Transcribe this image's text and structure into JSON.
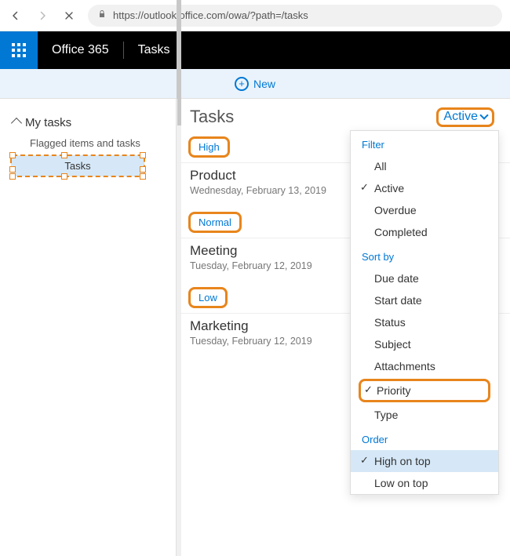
{
  "browser": {
    "url": "https://outlook.office.com/owa/?path=/tasks"
  },
  "suite": {
    "brand": "Office 365",
    "app": "Tasks"
  },
  "toolbar": {
    "new_label": "New"
  },
  "sidebar": {
    "header": "My tasks",
    "items": [
      {
        "label": "Flagged items and tasks",
        "selected": false
      },
      {
        "label": "Tasks",
        "selected": true
      }
    ]
  },
  "list": {
    "title": "Tasks",
    "filter_label": "Active",
    "groups": [
      {
        "label": "High",
        "tasks": [
          {
            "title": "Product",
            "date": "Wednesday, February 13, 2019"
          }
        ]
      },
      {
        "label": "Normal",
        "tasks": [
          {
            "title": "Meeting",
            "date": "Tuesday, February 12, 2019"
          }
        ]
      },
      {
        "label": "Low",
        "tasks": [
          {
            "title": "Marketing",
            "date": "Tuesday, February 12, 2019"
          }
        ]
      }
    ]
  },
  "dropdown": {
    "sections": {
      "filter_label": "Filter",
      "filter_items": [
        "All",
        "Active",
        "Overdue",
        "Completed"
      ],
      "filter_selected": "Active",
      "sort_label": "Sort by",
      "sort_items": [
        "Due date",
        "Start date",
        "Status",
        "Subject",
        "Attachments",
        "Priority",
        "Type"
      ],
      "sort_selected": "Priority",
      "order_label": "Order",
      "order_items": [
        "High on top",
        "Low on top"
      ],
      "order_selected": "High on top"
    }
  }
}
